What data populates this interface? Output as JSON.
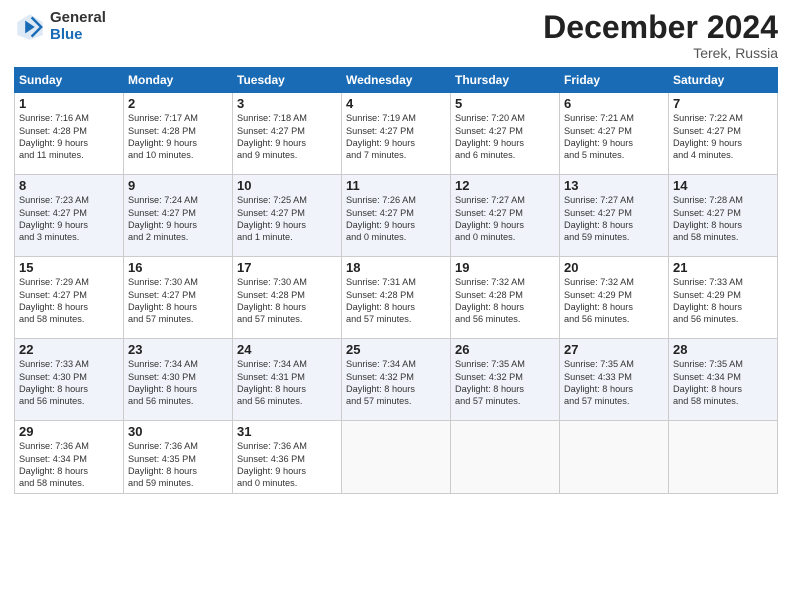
{
  "logo": {
    "general": "General",
    "blue": "Blue"
  },
  "title": "December 2024",
  "location": "Terek, Russia",
  "days_of_week": [
    "Sunday",
    "Monday",
    "Tuesday",
    "Wednesday",
    "Thursday",
    "Friday",
    "Saturday"
  ],
  "weeks": [
    [
      {
        "day": "1",
        "lines": [
          "Sunrise: 7:16 AM",
          "Sunset: 4:28 PM",
          "Daylight: 9 hours",
          "and 11 minutes."
        ]
      },
      {
        "day": "2",
        "lines": [
          "Sunrise: 7:17 AM",
          "Sunset: 4:28 PM",
          "Daylight: 9 hours",
          "and 10 minutes."
        ]
      },
      {
        "day": "3",
        "lines": [
          "Sunrise: 7:18 AM",
          "Sunset: 4:27 PM",
          "Daylight: 9 hours",
          "and 9 minutes."
        ]
      },
      {
        "day": "4",
        "lines": [
          "Sunrise: 7:19 AM",
          "Sunset: 4:27 PM",
          "Daylight: 9 hours",
          "and 7 minutes."
        ]
      },
      {
        "day": "5",
        "lines": [
          "Sunrise: 7:20 AM",
          "Sunset: 4:27 PM",
          "Daylight: 9 hours",
          "and 6 minutes."
        ]
      },
      {
        "day": "6",
        "lines": [
          "Sunrise: 7:21 AM",
          "Sunset: 4:27 PM",
          "Daylight: 9 hours",
          "and 5 minutes."
        ]
      },
      {
        "day": "7",
        "lines": [
          "Sunrise: 7:22 AM",
          "Sunset: 4:27 PM",
          "Daylight: 9 hours",
          "and 4 minutes."
        ]
      }
    ],
    [
      {
        "day": "8",
        "lines": [
          "Sunrise: 7:23 AM",
          "Sunset: 4:27 PM",
          "Daylight: 9 hours",
          "and 3 minutes."
        ]
      },
      {
        "day": "9",
        "lines": [
          "Sunrise: 7:24 AM",
          "Sunset: 4:27 PM",
          "Daylight: 9 hours",
          "and 2 minutes."
        ]
      },
      {
        "day": "10",
        "lines": [
          "Sunrise: 7:25 AM",
          "Sunset: 4:27 PM",
          "Daylight: 9 hours",
          "and 1 minute."
        ]
      },
      {
        "day": "11",
        "lines": [
          "Sunrise: 7:26 AM",
          "Sunset: 4:27 PM",
          "Daylight: 9 hours",
          "and 0 minutes."
        ]
      },
      {
        "day": "12",
        "lines": [
          "Sunrise: 7:27 AM",
          "Sunset: 4:27 PM",
          "Daylight: 9 hours",
          "and 0 minutes."
        ]
      },
      {
        "day": "13",
        "lines": [
          "Sunrise: 7:27 AM",
          "Sunset: 4:27 PM",
          "Daylight: 8 hours",
          "and 59 minutes."
        ]
      },
      {
        "day": "14",
        "lines": [
          "Sunrise: 7:28 AM",
          "Sunset: 4:27 PM",
          "Daylight: 8 hours",
          "and 58 minutes."
        ]
      }
    ],
    [
      {
        "day": "15",
        "lines": [
          "Sunrise: 7:29 AM",
          "Sunset: 4:27 PM",
          "Daylight: 8 hours",
          "and 58 minutes."
        ]
      },
      {
        "day": "16",
        "lines": [
          "Sunrise: 7:30 AM",
          "Sunset: 4:27 PM",
          "Daylight: 8 hours",
          "and 57 minutes."
        ]
      },
      {
        "day": "17",
        "lines": [
          "Sunrise: 7:30 AM",
          "Sunset: 4:28 PM",
          "Daylight: 8 hours",
          "and 57 minutes."
        ]
      },
      {
        "day": "18",
        "lines": [
          "Sunrise: 7:31 AM",
          "Sunset: 4:28 PM",
          "Daylight: 8 hours",
          "and 57 minutes."
        ]
      },
      {
        "day": "19",
        "lines": [
          "Sunrise: 7:32 AM",
          "Sunset: 4:28 PM",
          "Daylight: 8 hours",
          "and 56 minutes."
        ]
      },
      {
        "day": "20",
        "lines": [
          "Sunrise: 7:32 AM",
          "Sunset: 4:29 PM",
          "Daylight: 8 hours",
          "and 56 minutes."
        ]
      },
      {
        "day": "21",
        "lines": [
          "Sunrise: 7:33 AM",
          "Sunset: 4:29 PM",
          "Daylight: 8 hours",
          "and 56 minutes."
        ]
      }
    ],
    [
      {
        "day": "22",
        "lines": [
          "Sunrise: 7:33 AM",
          "Sunset: 4:30 PM",
          "Daylight: 8 hours",
          "and 56 minutes."
        ]
      },
      {
        "day": "23",
        "lines": [
          "Sunrise: 7:34 AM",
          "Sunset: 4:30 PM",
          "Daylight: 8 hours",
          "and 56 minutes."
        ]
      },
      {
        "day": "24",
        "lines": [
          "Sunrise: 7:34 AM",
          "Sunset: 4:31 PM",
          "Daylight: 8 hours",
          "and 56 minutes."
        ]
      },
      {
        "day": "25",
        "lines": [
          "Sunrise: 7:34 AM",
          "Sunset: 4:32 PM",
          "Daylight: 8 hours",
          "and 57 minutes."
        ]
      },
      {
        "day": "26",
        "lines": [
          "Sunrise: 7:35 AM",
          "Sunset: 4:32 PM",
          "Daylight: 8 hours",
          "and 57 minutes."
        ]
      },
      {
        "day": "27",
        "lines": [
          "Sunrise: 7:35 AM",
          "Sunset: 4:33 PM",
          "Daylight: 8 hours",
          "and 57 minutes."
        ]
      },
      {
        "day": "28",
        "lines": [
          "Sunrise: 7:35 AM",
          "Sunset: 4:34 PM",
          "Daylight: 8 hours",
          "and 58 minutes."
        ]
      }
    ],
    [
      {
        "day": "29",
        "lines": [
          "Sunrise: 7:36 AM",
          "Sunset: 4:34 PM",
          "Daylight: 8 hours",
          "and 58 minutes."
        ]
      },
      {
        "day": "30",
        "lines": [
          "Sunrise: 7:36 AM",
          "Sunset: 4:35 PM",
          "Daylight: 8 hours",
          "and 59 minutes."
        ]
      },
      {
        "day": "31",
        "lines": [
          "Sunrise: 7:36 AM",
          "Sunset: 4:36 PM",
          "Daylight: 9 hours",
          "and 0 minutes."
        ]
      },
      null,
      null,
      null,
      null
    ]
  ]
}
